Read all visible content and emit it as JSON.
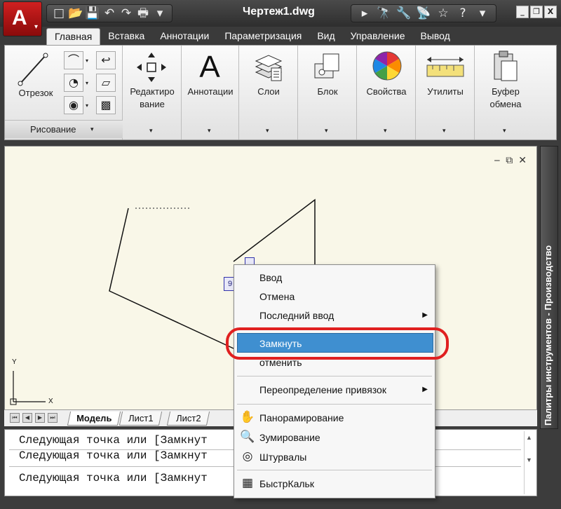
{
  "window": {
    "title": "Чертеж1.dwg"
  },
  "app_button": {
    "letter": "A",
    "arrow": "▾"
  },
  "quick_access": [
    "□",
    "📂",
    "💾",
    "↶",
    "↷",
    "🖶",
    "▾"
  ],
  "search_tools": [
    "▸",
    "🔭",
    "🔧",
    "📡",
    "☆",
    "?",
    "▾"
  ],
  "window_controls": [
    "_",
    "❐",
    "X"
  ],
  "ribbon_tabs": [
    {
      "label": "Главная",
      "active": true
    },
    {
      "label": "Вставка",
      "active": false
    },
    {
      "label": "Аннотации",
      "active": false
    },
    {
      "label": "Параметризация",
      "active": false
    },
    {
      "label": "Вид",
      "active": false
    },
    {
      "label": "Управление",
      "active": false
    },
    {
      "label": "Вывод",
      "active": false
    }
  ],
  "ribbon": {
    "draw_panel_label": "Рисование",
    "line_tool_label": "Отрезок",
    "modify_label_1": "Редактиро",
    "modify_label_2": "вание",
    "annotation_label": "Аннотации",
    "layers_label": "Слои",
    "block_label": "Блок",
    "properties_label": "Свойства",
    "utilities_label": "Утилиты",
    "clipboard_label_1": "Буфер",
    "clipboard_label_2": "обмена",
    "annotation_icon_text": "A"
  },
  "canvas": {
    "controls": [
      "‒",
      "⧉",
      "✕"
    ],
    "ucs_y": "Y",
    "ucs_x": "X"
  },
  "tool_palette": {
    "label": "Палитры инструментов - Производство"
  },
  "layout_tabs": [
    {
      "label": "Модель",
      "active": true
    },
    {
      "label": "Лист1",
      "active": false
    },
    {
      "label": "Лист2",
      "active": false
    }
  ],
  "layout_nav": [
    "⏮",
    "◀",
    "▶",
    "⏭"
  ],
  "command_lines": [
    "Следующая точка или [Замкнут",
    "Следующая точка или [Замкнут",
    "Следующая точка или [Замкнут"
  ],
  "context_menu": {
    "items": [
      {
        "label": "Ввод"
      },
      {
        "label": "Отмена"
      },
      {
        "label": "Последний ввод",
        "submenu": "▶"
      },
      {
        "label": "Замкнуть",
        "highlighted": true
      },
      {
        "label": "отменить"
      },
      {
        "label": "Переопределение привязок",
        "submenu": "▶"
      },
      {
        "label": "Панорамирование",
        "icon": "✋"
      },
      {
        "label": "Зумирование",
        "icon": "🔍"
      },
      {
        "label": "Штурвалы",
        "icon": "◎"
      },
      {
        "label": "БыстрКальк",
        "icon": "▦"
      }
    ]
  },
  "cursor_input": {
    "value": "9"
  },
  "colors": {
    "highlight": "#3f8fd0",
    "annotation_oval": "#e02020",
    "canvas_bg": "#f9f7e8"
  }
}
